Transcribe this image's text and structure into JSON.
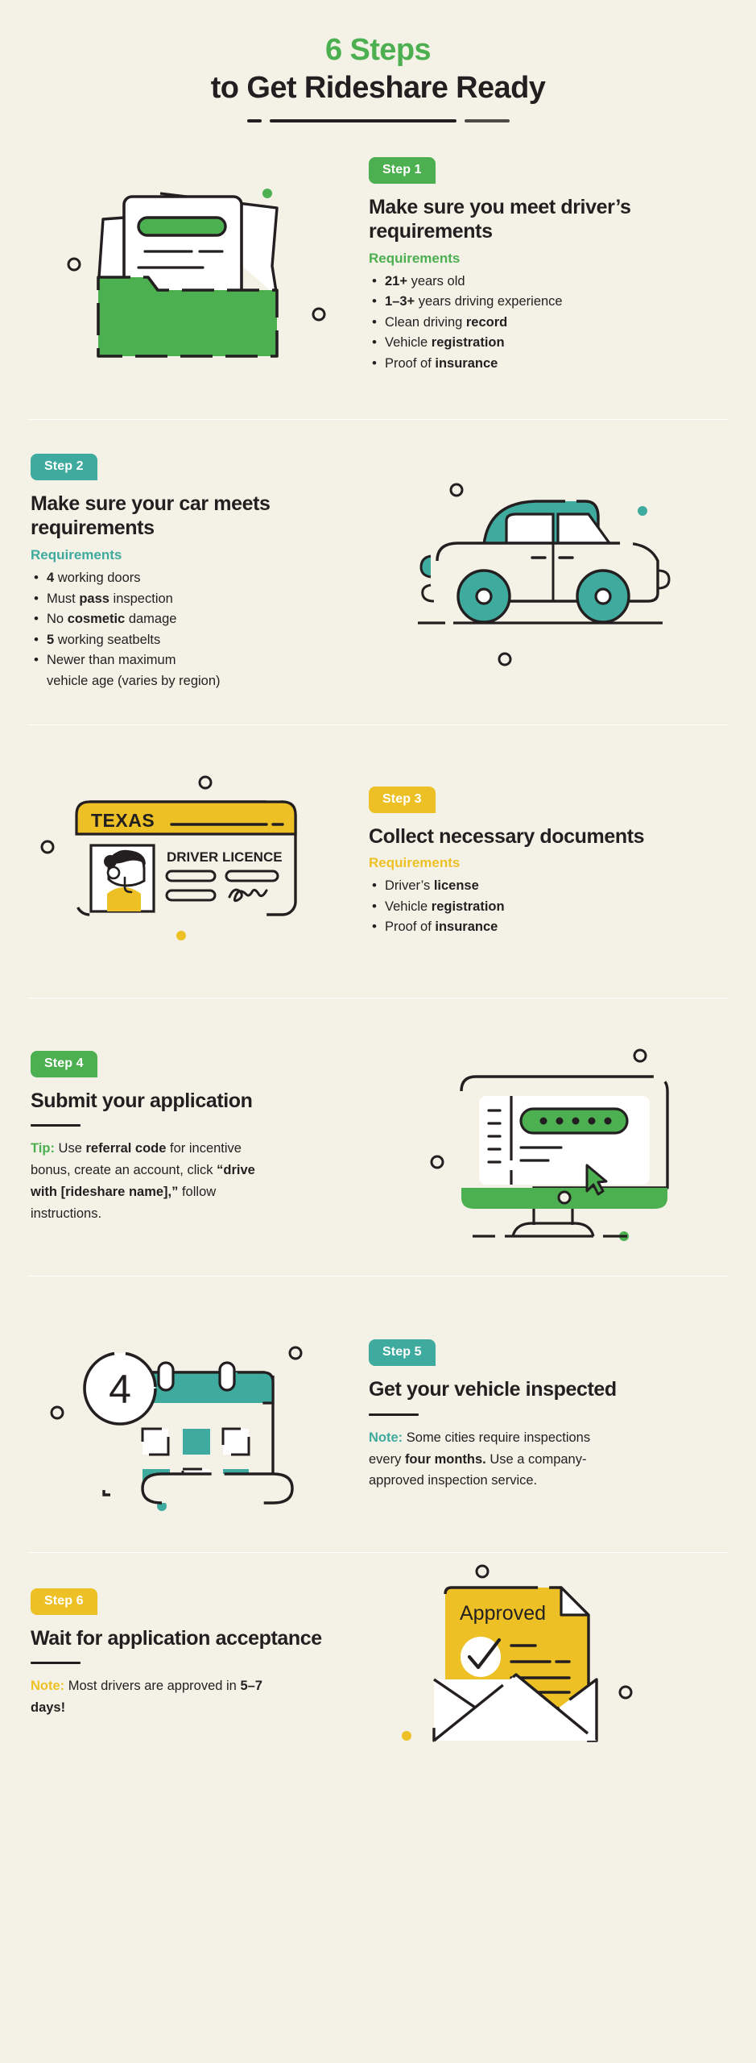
{
  "palette": {
    "background": "#f4f2e7",
    "ink": "#231f20",
    "green": "#4caf50",
    "teal": "#3faa9e",
    "yellow": "#edc125",
    "white": "#ffffff"
  },
  "header": {
    "title_line1": "6 Steps",
    "title_line2": "to Get Rideshare Ready"
  },
  "steps": [
    {
      "badge": "Step 1",
      "accent": "green",
      "title": "Make sure you meet driver’s requirements",
      "list_label": "Requirements",
      "items": [
        {
          "strong": "21+",
          "rest": " years old",
          "bold_first": true
        },
        {
          "strong": "1–3+",
          "rest": " years driving experience",
          "bold_first": true
        },
        {
          "lead": "Clean driving ",
          "strong": "record",
          "bold_first": false
        },
        {
          "lead": "Vehicle ",
          "strong": "registration",
          "bold_first": false
        },
        {
          "lead": "Proof of ",
          "strong": "insurance",
          "bold_first": false
        }
      ],
      "illustration": "folder-with-documents"
    },
    {
      "badge": "Step 2",
      "accent": "teal",
      "title": "Make sure your car meets requirements",
      "list_label": "Requirements",
      "items": [
        {
          "strong": "4",
          "rest": " working doors",
          "bold_first": true
        },
        {
          "lead": "Must ",
          "strong": "pass",
          "rest": " inspection",
          "bold_first": false
        },
        {
          "lead": "No ",
          "strong": "cosmetic",
          "rest": " damage",
          "bold_first": false
        },
        {
          "strong": "5",
          "rest": " working seatbelts",
          "bold_first": true
        },
        {
          "lead": "Newer than maximum vehicle age (varies by region)",
          "bold_first": false
        }
      ],
      "illustration": "car-side-view"
    },
    {
      "badge": "Step 3",
      "accent": "yellow",
      "title": "Collect necessary documents",
      "list_label": "Requirements",
      "items": [
        {
          "lead": "Driver’s ",
          "strong": "license",
          "bold_first": false
        },
        {
          "lead": "Vehicle ",
          "strong": "registration",
          "bold_first": false
        },
        {
          "lead": "Proof of ",
          "strong": "insurance",
          "bold_first": false
        }
      ],
      "illustration": "drivers-licence-card"
    },
    {
      "badge": "Step 4",
      "accent": "green",
      "title": "Submit your application",
      "note_lead": "Tip:",
      "note_parts": [
        {
          "text": " Use ",
          "bold": false
        },
        {
          "text": "referral code",
          "bold": true
        },
        {
          "text": " for incentive bonus, create an account, click ",
          "bold": false
        },
        {
          "text": "“drive with [rideshare name],”",
          "bold": true
        },
        {
          "text": " follow instructions.",
          "bold": false
        }
      ],
      "illustration": "desktop-monitor-form"
    },
    {
      "badge": "Step 5",
      "accent": "teal",
      "title": "Get your vehicle inspected",
      "note_lead": "Note:",
      "note_parts": [
        {
          "text": " Some cities require inspections every ",
          "bold": false
        },
        {
          "text": "four months.",
          "bold": true
        },
        {
          "text": " Use a company-approved inspection service.",
          "bold": false
        }
      ],
      "illustration": "calendar-four"
    },
    {
      "badge": "Step 6",
      "accent": "yellow",
      "title": "Wait for application acceptance",
      "note_lead": "Note:",
      "note_parts": [
        {
          "text": " Most drivers are approved in ",
          "bold": false
        },
        {
          "text": "5–7 days!",
          "bold": true
        }
      ],
      "illustration": "envelope-approved"
    }
  ],
  "illustration_text": {
    "licence_state": "TEXAS",
    "licence_label": "DRIVER LICENCE",
    "calendar_number": "4",
    "envelope_word": "Approved"
  }
}
